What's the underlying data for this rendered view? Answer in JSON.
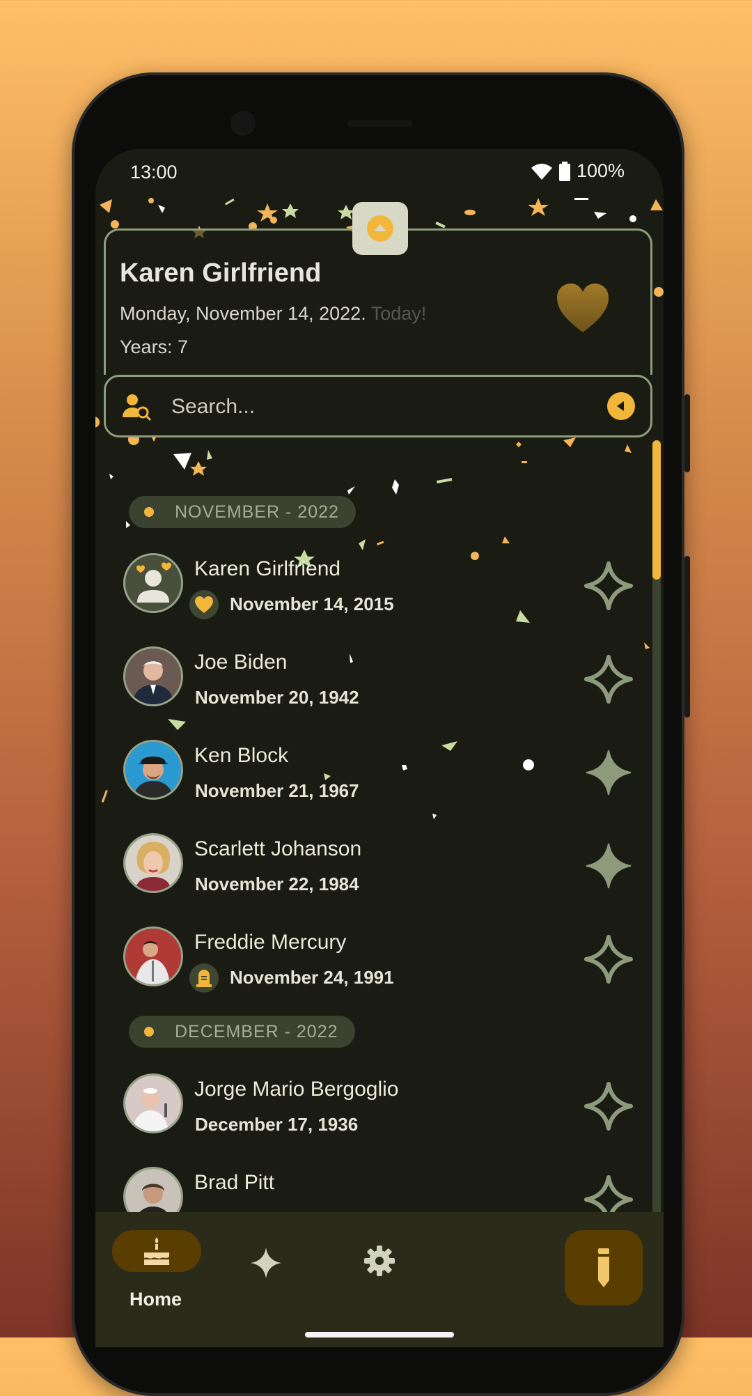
{
  "status_bar": {
    "time": "13:00",
    "battery": "100%"
  },
  "card": {
    "name": "Karen Girlfriend",
    "date": "Monday, November 14, 2022.",
    "today": "Today!",
    "years": "Years: 7"
  },
  "search": {
    "placeholder": "Search..."
  },
  "sections": [
    {
      "label": "NOVEMBER - 2022"
    },
    {
      "label": "DECEMBER - 2022"
    }
  ],
  "people": [
    {
      "name": "Karen Girlfriend",
      "date": "November 14, 2015",
      "badge": "heart-icon",
      "favorite": false
    },
    {
      "name": "Joe Biden",
      "date": "November 20, 1942",
      "favorite": false
    },
    {
      "name": "Ken Block",
      "date": "November 21, 1967",
      "favorite": true
    },
    {
      "name": "Scarlett Johanson",
      "date": "November 22, 1984",
      "favorite": true
    },
    {
      "name": "Freddie Mercury",
      "date": "November 24, 1991",
      "badge": "tombstone-icon",
      "favorite": false
    },
    {
      "name": "Jorge Mario Bergoglio",
      "date": "December 17, 1936",
      "favorite": false
    },
    {
      "name": "Brad Pitt",
      "date": "",
      "favorite": false
    }
  ],
  "nav": {
    "home_label": "Home"
  },
  "colors": {
    "accent": "#f2b73a",
    "surface": "#1a1c14",
    "outline": "#8f9c7c",
    "nav": "#2b2b1a"
  }
}
